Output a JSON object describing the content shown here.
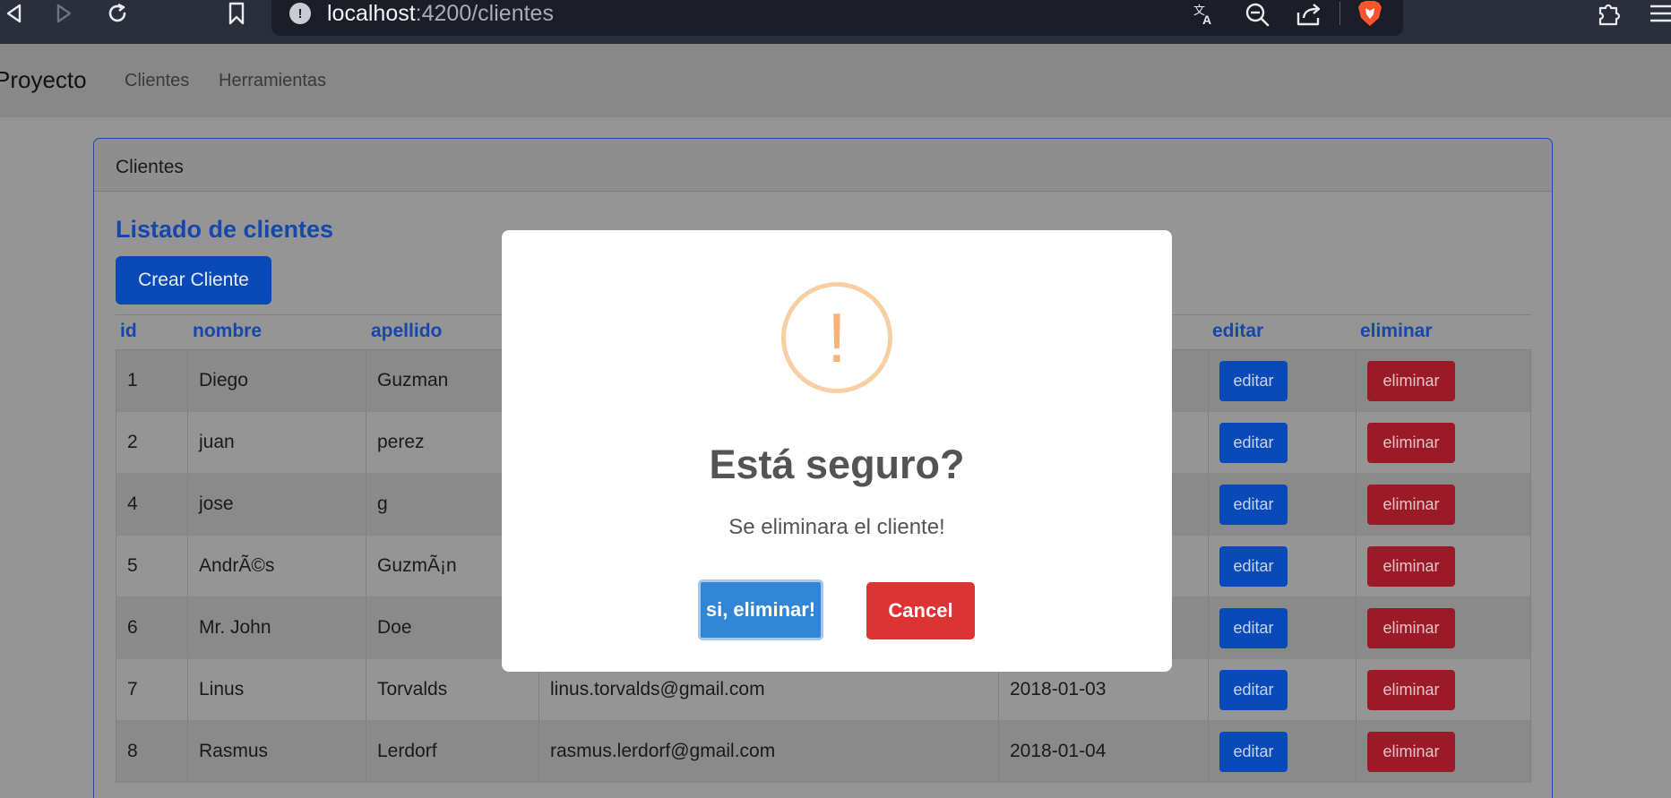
{
  "browser": {
    "url_host": "localhost",
    "url_path": ":4200/clientes",
    "info_icon": "!",
    "icons": [
      "back-icon",
      "forward-icon",
      "reload-icon",
      "bookmark-icon",
      "translate-icon",
      "zoom-out-icon",
      "share-icon",
      "brave-shield-icon",
      "extensions-icon",
      "menu-icon"
    ]
  },
  "navbar": {
    "brand": "Proyecto",
    "links": [
      "Clientes",
      "Herramientas"
    ]
  },
  "card": {
    "header": "Clientes",
    "title": "Listado de clientes",
    "create_button": "Crear Cliente"
  },
  "table": {
    "columns": [
      "id",
      "nombre",
      "apellido",
      "editar",
      "eliminar"
    ],
    "edit_label": "editar",
    "delete_label": "eliminar",
    "rows": [
      {
        "id": "1",
        "nombre": "Diego",
        "apellido": "Guzman",
        "email": "",
        "fecha": ""
      },
      {
        "id": "2",
        "nombre": "juan",
        "apellido": "perez",
        "email": "",
        "fecha": ""
      },
      {
        "id": "4",
        "nombre": "jose",
        "apellido": "g",
        "email": "",
        "fecha": ""
      },
      {
        "id": "5",
        "nombre": "AndrÃ©s",
        "apellido": "GuzmÃ¡n",
        "email": "",
        "fecha": ""
      },
      {
        "id": "6",
        "nombre": "Mr. John",
        "apellido": "Doe",
        "email": "",
        "fecha": ""
      },
      {
        "id": "7",
        "nombre": "Linus",
        "apellido": "Torvalds",
        "email": "linus.torvalds@gmail.com",
        "fecha": "2018-01-03"
      },
      {
        "id": "8",
        "nombre": "Rasmus",
        "apellido": "Lerdorf",
        "email": "rasmus.lerdorf@gmail.com",
        "fecha": "2018-01-04"
      }
    ]
  },
  "modal": {
    "icon": "!",
    "title": "Está seguro?",
    "text": "Se eliminara el cliente!",
    "confirm": "si, eliminar!",
    "cancel": "Cancel"
  },
  "colors": {
    "primary": "#0a49b8",
    "danger": "#9b1a27",
    "confirm": "#3085d6",
    "cancel": "#dd3333",
    "warning": "#f7b277"
  }
}
